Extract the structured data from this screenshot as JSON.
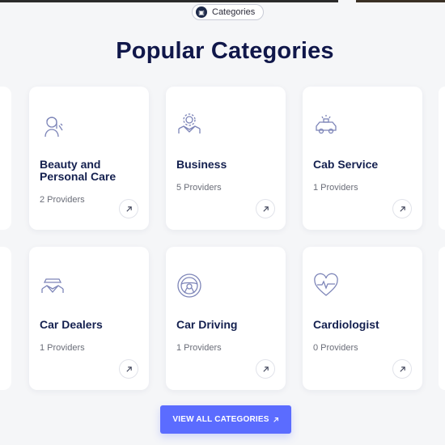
{
  "badge": {
    "label": "Categories",
    "icon": "category-icon"
  },
  "title": "Popular Categories",
  "categories": [
    {
      "name": "Beauty and Personal Care",
      "providers": "2 Providers",
      "icon": "beauty-icon"
    },
    {
      "name": "Business",
      "providers": "5 Providers",
      "icon": "business-icon"
    },
    {
      "name": "Cab Service",
      "providers": "1 Providers",
      "icon": "cab-icon"
    },
    {
      "name": "Car Dealers",
      "providers": "1 Providers",
      "icon": "car-dealer-icon"
    },
    {
      "name": "Car Driving",
      "providers": "1 Providers",
      "icon": "steering-wheel-icon"
    },
    {
      "name": "Cardiologist",
      "providers": "0 Providers",
      "icon": "heartbeat-icon"
    }
  ],
  "view_all": {
    "label": "VIEW ALL CATEGORIES",
    "icon": "arrow-up-right-icon"
  },
  "colors": {
    "accent": "#5b6cff",
    "title": "#10174a",
    "icon_stroke": "#7d85b8"
  }
}
